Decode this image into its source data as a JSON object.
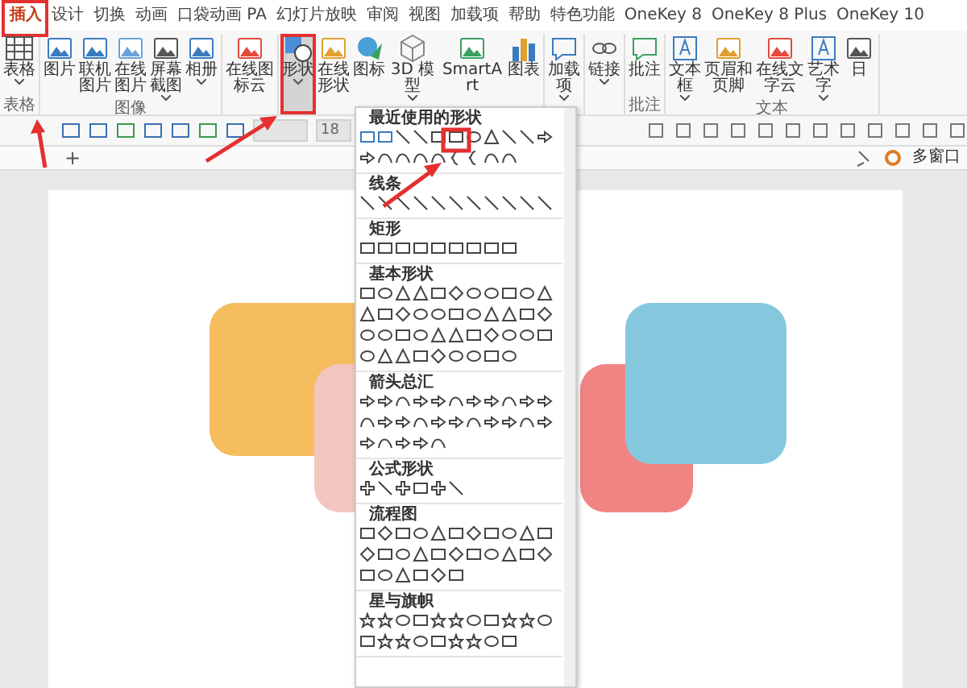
{
  "tabs": [
    {
      "label": "插入",
      "selected": true
    },
    {
      "label": "设计",
      "selected": false
    },
    {
      "label": "切换",
      "selected": false
    },
    {
      "label": "动画",
      "selected": false
    },
    {
      "label": "口袋动画 PA",
      "selected": false
    },
    {
      "label": "幻灯片放映",
      "selected": false
    },
    {
      "label": "审阅",
      "selected": false
    },
    {
      "label": "视图",
      "selected": false
    },
    {
      "label": "加载项",
      "selected": false
    },
    {
      "label": "帮助",
      "selected": false
    },
    {
      "label": "特色功能",
      "selected": false
    },
    {
      "label": "OneKey 8",
      "selected": false
    },
    {
      "label": "OneKey 8 Plus",
      "selected": false
    },
    {
      "label": "OneKey 10",
      "selected": false
    }
  ],
  "ribbon": {
    "groups": [
      {
        "label": "表格",
        "items": [
          {
            "label": "表格",
            "kind": "table",
            "dropdown": true,
            "selected": false
          }
        ]
      },
      {
        "label": "图像",
        "items": [
          {
            "label": "图片",
            "kind": "image",
            "dropdown": false,
            "selected": false
          },
          {
            "label": "联机图片",
            "kind": "globe-image",
            "dropdown": false,
            "selected": false
          },
          {
            "label": "在线图片",
            "kind": "cloud-image",
            "dropdown": false,
            "selected": false
          },
          {
            "label": "屏幕截图",
            "kind": "camera",
            "dropdown": true,
            "selected": false
          },
          {
            "label": "相册",
            "kind": "album",
            "dropdown": true,
            "selected": false
          }
        ]
      },
      {
        "items": [
          {
            "label": "在线图标云",
            "kind": "badge",
            "dropdown": false,
            "selected": false
          }
        ]
      },
      {
        "items": [
          {
            "label": "形状",
            "kind": "shapes",
            "dropdown": true,
            "selected": true
          },
          {
            "label": "在线形状",
            "kind": "colorful",
            "dropdown": false,
            "selected": false
          },
          {
            "label": "图标",
            "kind": "bird",
            "dropdown": false,
            "selected": false
          },
          {
            "label": "3D 模型",
            "kind": "cube",
            "dropdown": true,
            "selected": false
          },
          {
            "label": "SmartArt",
            "kind": "smartart",
            "dropdown": false,
            "selected": false
          },
          {
            "label": "图表",
            "kind": "chart",
            "dropdown": false,
            "selected": false
          }
        ]
      },
      {
        "items": [
          {
            "label": "加载项",
            "kind": "addin",
            "dropdown": true,
            "selected": false
          }
        ]
      },
      {
        "items": [
          {
            "label": "链接",
            "kind": "link",
            "dropdown": true,
            "selected": false
          }
        ]
      },
      {
        "label": "批注",
        "items": [
          {
            "label": "批注",
            "kind": "comment",
            "dropdown": false,
            "selected": false
          }
        ]
      },
      {
        "label": "文本",
        "items": [
          {
            "label": "文本框",
            "kind": "textbox",
            "dropdown": true,
            "selected": false
          },
          {
            "label": "页眉和页脚",
            "kind": "header",
            "dropdown": false,
            "selected": false
          },
          {
            "label": "在线文字云",
            "kind": "wordcloud",
            "dropdown": false,
            "selected": false
          },
          {
            "label": "艺术字",
            "kind": "wordart",
            "dropdown": true,
            "selected": false
          },
          {
            "label": "日",
            "kind": "date",
            "dropdown": false,
            "selected": false
          }
        ]
      }
    ]
  },
  "toolbar": {
    "font_size": "18"
  },
  "tab_strip": {
    "new_tab": "+",
    "window_label": "多窗口"
  },
  "shape_menu": {
    "sections": [
      {
        "title": "最近使用的形状"
      },
      {
        "title": "线条"
      },
      {
        "title": "矩形"
      },
      {
        "title": "基本形状"
      },
      {
        "title": "箭头总汇"
      },
      {
        "title": "公式形状"
      },
      {
        "title": "流程图"
      },
      {
        "title": "星与旗帜"
      }
    ]
  }
}
